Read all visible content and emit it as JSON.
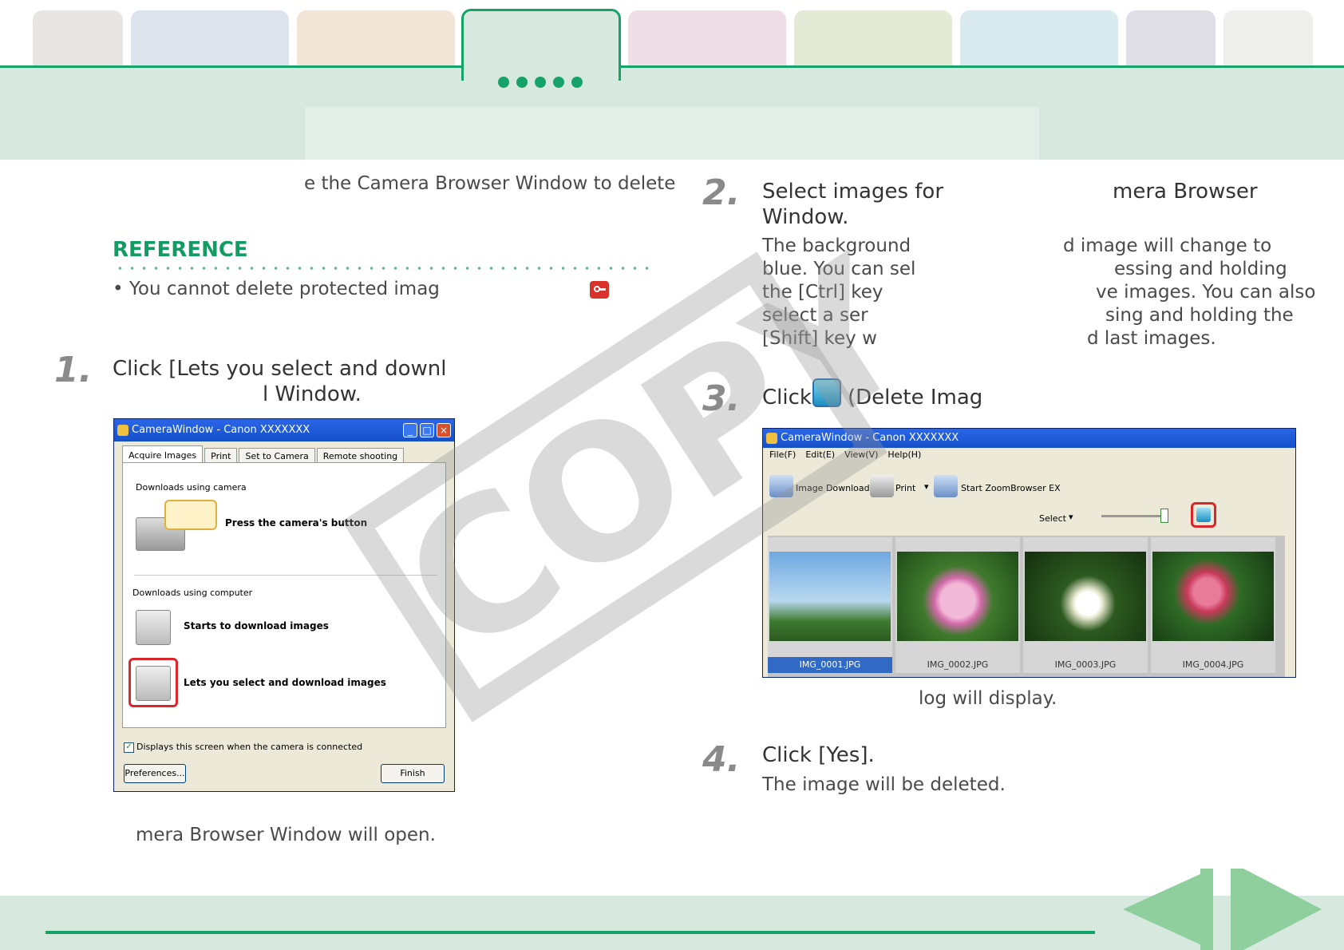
{
  "colors": {
    "accent": "#16a36a",
    "reference": "#119c63",
    "band": "#d7e8df"
  },
  "intro_text": "e the Camera Browser Window to delete",
  "reference": {
    "heading": "REFERENCE",
    "bullet": "• You cannot delete protected imag",
    "icon": "protect-key-icon"
  },
  "steps": [
    {
      "num": "1.",
      "title_line1": "Click [Lets you select and downl",
      "title_line2": "l Window.",
      "result": "mera Browser Window will open."
    },
    {
      "num": "2.",
      "title_line1": "Select images for",
      "title_line1b": "mera Browser",
      "title_line2": "Window.",
      "body_left": [
        "The background",
        "blue. You can sel",
        "the [Ctrl] key",
        "select a ser",
        "[Shift] key w"
      ],
      "body_right": [
        "d image will change to",
        "essing and holding",
        "ve images. You can also",
        "sing and holding the",
        "d last images."
      ]
    },
    {
      "num": "3.",
      "title_pre": "Click",
      "title_post": "(Delete Imag",
      "result": "log will display."
    },
    {
      "num": "4.",
      "title": "Click [Yes].",
      "body": "The image will be deleted."
    }
  ],
  "camera_window": {
    "title": "CameraWindow - Canon XXXXXXX",
    "tabs": [
      "Acquire Images",
      "Print",
      "Set to Camera",
      "Remote shooting"
    ],
    "section1": "Downloads using camera",
    "press_button": "Press the camera's button",
    "section2": "Downloads using computer",
    "starts_download": "Starts to download images",
    "select_download": "Lets you select and download images",
    "checkbox": "Displays this screen when the camera is connected",
    "preferences": "Preferences...",
    "finish": "Finish"
  },
  "browser_window": {
    "title": "CameraWindow - Canon XXXXXXX",
    "menu": [
      "File(F)",
      "Edit(E)",
      "View(V)",
      "Help(H)"
    ],
    "toolbar": {
      "download": "Image Download",
      "print": "Print",
      "zoombrowser": "Start ZoomBrowser EX",
      "select": "Select"
    },
    "files": [
      "IMG_0001.JPG",
      "IMG_0002.JPG",
      "IMG_0003.JPG",
      "IMG_0004.JPG"
    ]
  },
  "watermark": "COPY"
}
